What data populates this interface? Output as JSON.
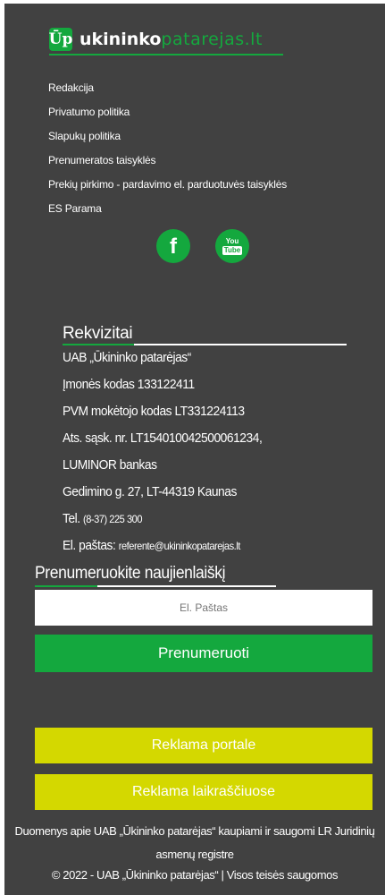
{
  "logo": {
    "mark": "Ūp",
    "name_main": "ukininko",
    "name_accent": "patarejas.lt"
  },
  "links": [
    "Redakcija",
    "Privatumo politika",
    "Slapukų politika",
    "Prenumeratos taisyklės",
    "Prekių pirkimo - pardavimo el. parduotuvės taisyklės",
    "ES Parama"
  ],
  "social": {
    "facebook_glyph": "f",
    "youtube_you": "You",
    "youtube_tube": "Tube"
  },
  "rekvizitai": {
    "title": "Rekvizitai",
    "company": "UAB „Ūkininko patarėjas“",
    "company_code": "Įmonės kodas 133122411",
    "vat_code": "PVM mokėtojo kodas LT331224113",
    "account": "Ats. sąsk. nr. LT154010042500061234,",
    "bank": "LUMINOR bankas",
    "address": "Gedimino g. 27, LT-44319 Kaunas",
    "phone_label": "Tel.",
    "phone_value": "(8-37) 225 300",
    "email_label": "El. paštas:",
    "email_value": "referente@ukininkopatarejas.lt"
  },
  "newsletter": {
    "title": "Prenumeruokite naujienlaiškį",
    "email_placeholder": "El. Paštas",
    "subscribe_label": "Prenumeruoti"
  },
  "ads": {
    "portal_label": "Reklama portale",
    "newspapers_label": "Reklama laikraščiuose"
  },
  "bottom": {
    "registry_text": "Duomenys apie UAB „Ūkininko patarėjas“ kaupiami ir saugomi LR Juridinių asmenų registre",
    "copyright": "© 2022 - UAB „Ūkininko patarėjas“ | Visos teisės saugomos"
  },
  "colors": {
    "background": "#414141",
    "brand_green": "#14a83e",
    "ad_yellow": "#d4d800"
  }
}
